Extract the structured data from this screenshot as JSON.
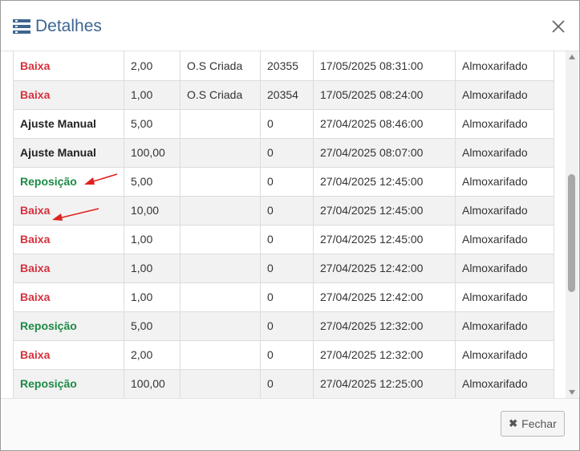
{
  "modal": {
    "title": "Detalhes",
    "title_icon": "list-icon",
    "close_icon": "close-icon"
  },
  "rows": [
    {
      "tipo": "Baixa",
      "tipo_kind": "baixa",
      "quantidade": "2,00",
      "origem": "O.S Criada",
      "numero": "20355",
      "data": "17/05/2025 08:31:00",
      "local": "Almoxarifado"
    },
    {
      "tipo": "Baixa",
      "tipo_kind": "baixa",
      "quantidade": "1,00",
      "origem": "O.S Criada",
      "numero": "20354",
      "data": "17/05/2025 08:24:00",
      "local": "Almoxarifado"
    },
    {
      "tipo": "Ajuste Manual",
      "tipo_kind": "ajuste",
      "quantidade": "5,00",
      "origem": "",
      "numero": "0",
      "data": "27/04/2025 08:46:00",
      "local": "Almoxarifado"
    },
    {
      "tipo": "Ajuste Manual",
      "tipo_kind": "ajuste",
      "quantidade": "100,00",
      "origem": "",
      "numero": "0",
      "data": "27/04/2025 08:07:00",
      "local": "Almoxarifado"
    },
    {
      "tipo": "Reposição",
      "tipo_kind": "repo",
      "quantidade": "5,00",
      "origem": "",
      "numero": "0",
      "data": "27/04/2025 12:45:00",
      "local": "Almoxarifado"
    },
    {
      "tipo": "Baixa",
      "tipo_kind": "baixa",
      "quantidade": "10,00",
      "origem": "",
      "numero": "0",
      "data": "27/04/2025 12:45:00",
      "local": "Almoxarifado"
    },
    {
      "tipo": "Baixa",
      "tipo_kind": "baixa",
      "quantidade": "1,00",
      "origem": "",
      "numero": "0",
      "data": "27/04/2025 12:45:00",
      "local": "Almoxarifado"
    },
    {
      "tipo": "Baixa",
      "tipo_kind": "baixa",
      "quantidade": "1,00",
      "origem": "",
      "numero": "0",
      "data": "27/04/2025 12:42:00",
      "local": "Almoxarifado"
    },
    {
      "tipo": "Baixa",
      "tipo_kind": "baixa",
      "quantidade": "1,00",
      "origem": "",
      "numero": "0",
      "data": "27/04/2025 12:42:00",
      "local": "Almoxarifado"
    },
    {
      "tipo": "Reposição",
      "tipo_kind": "repo",
      "quantidade": "5,00",
      "origem": "",
      "numero": "0",
      "data": "27/04/2025 12:32:00",
      "local": "Almoxarifado"
    },
    {
      "tipo": "Baixa",
      "tipo_kind": "baixa",
      "quantidade": "2,00",
      "origem": "",
      "numero": "0",
      "data": "27/04/2025 12:32:00",
      "local": "Almoxarifado"
    },
    {
      "tipo": "Reposição",
      "tipo_kind": "repo",
      "quantidade": "100,00",
      "origem": "",
      "numero": "0",
      "data": "27/04/2025 12:25:00",
      "local": "Almoxarifado"
    }
  ],
  "colors": {
    "baixa": "#d6313e",
    "reposicao": "#1c8a45",
    "annotation_arrow": "#e02020",
    "title": "#3d6690"
  },
  "footer": {
    "close_label": "Fechar",
    "close_icon": "times-icon"
  }
}
